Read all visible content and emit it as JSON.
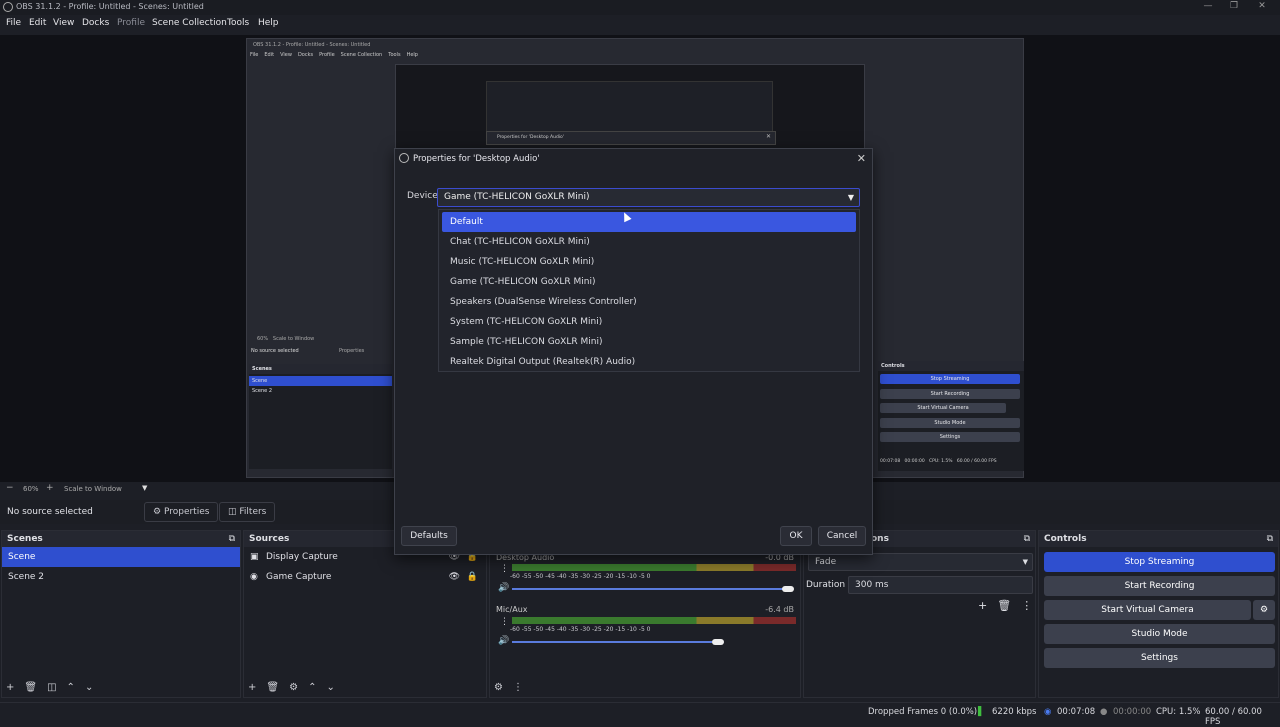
{
  "window": {
    "title": "OBS 31.1.2 - Profile: Untitled - Scenes: Untitled"
  },
  "menu": [
    "File",
    "Edit",
    "View",
    "Docks",
    "Profile",
    "Scene Collection",
    "Tools",
    "Help"
  ],
  "preview": {
    "zoom": "60%",
    "scale_mode": "Scale to Window"
  },
  "source_bar": {
    "selection": "No source selected",
    "properties": "Properties",
    "filters": "Filters"
  },
  "scenes": {
    "title": "Scenes",
    "items": [
      "Scene",
      "Scene 2"
    ]
  },
  "sources": {
    "title": "Sources",
    "items": [
      "Display Capture",
      "Game Capture"
    ]
  },
  "mixer": {
    "channels": [
      {
        "name": "Desktop Audio",
        "db": "-0.0 dB"
      },
      {
        "name": "Mic/Aux",
        "db": "-6.4 dB"
      }
    ],
    "ticks": "-60 -55 -50 -45 -40 -35 -30 -25 -20 -15 -10 -5 0"
  },
  "transitions": {
    "title": "ons",
    "type": "Fade",
    "duration_label": "Duration",
    "duration": "300 ms"
  },
  "controls": {
    "title": "Controls",
    "stop_streaming": "Stop Streaming",
    "start_recording": "Start Recording",
    "start_virtual_camera": "Start Virtual Camera",
    "studio_mode": "Studio Mode",
    "settings": "Settings"
  },
  "status": {
    "dropped": "Dropped Frames 0 (0.0%)",
    "bitrate": "6220 kbps",
    "stream_time": "00:07:08",
    "rec_time": "00:00:00",
    "cpu": "CPU: 1.5%",
    "fps": "60.00 / 60.00 FPS"
  },
  "dialog": {
    "title": "Properties for 'Desktop Audio'",
    "device_label": "Device",
    "device_value": "Game (TC-HELICON GoXLR Mini)",
    "defaults": "Defaults",
    "ok": "OK",
    "cancel": "Cancel",
    "options": [
      "Default",
      "Chat (TC-HELICON GoXLR Mini)",
      "Music (TC-HELICON GoXLR Mini)",
      "Game (TC-HELICON GoXLR Mini)",
      "Speakers (DualSense Wireless Controller)",
      "System (TC-HELICON GoXLR Mini)",
      "Sample (TC-HELICON GoXLR Mini)",
      "Realtek Digital Output (Realtek(R) Audio)"
    ]
  },
  "nested": {
    "title": "OBS 31.1.2 - Profile: Untitled - Scenes: Untitled",
    "menu": [
      "File",
      "Edit",
      "View",
      "Docks",
      "Profile",
      "Scene Collection",
      "Tools",
      "Help"
    ],
    "dialog_title": "Properties for 'Desktop Audio'",
    "zoom": "60%",
    "scale_mode": "Scale to Window",
    "selection": "No source selected",
    "properties": "Properties",
    "scenes_title": "Scenes",
    "scene1": "Scene",
    "scene2": "Scene 2",
    "controls_title": "Controls",
    "stop": "Stop Streaming",
    "rec": "Start Recording",
    "vcam": "Start Virtual Camera",
    "studio": "Studio Mode",
    "settings": "Settings",
    "stream_time": "00:07:08",
    "rec_time": "00:00:00",
    "cpu": "CPU: 1.5%",
    "fps": "60.00 / 60.00 FPS"
  }
}
